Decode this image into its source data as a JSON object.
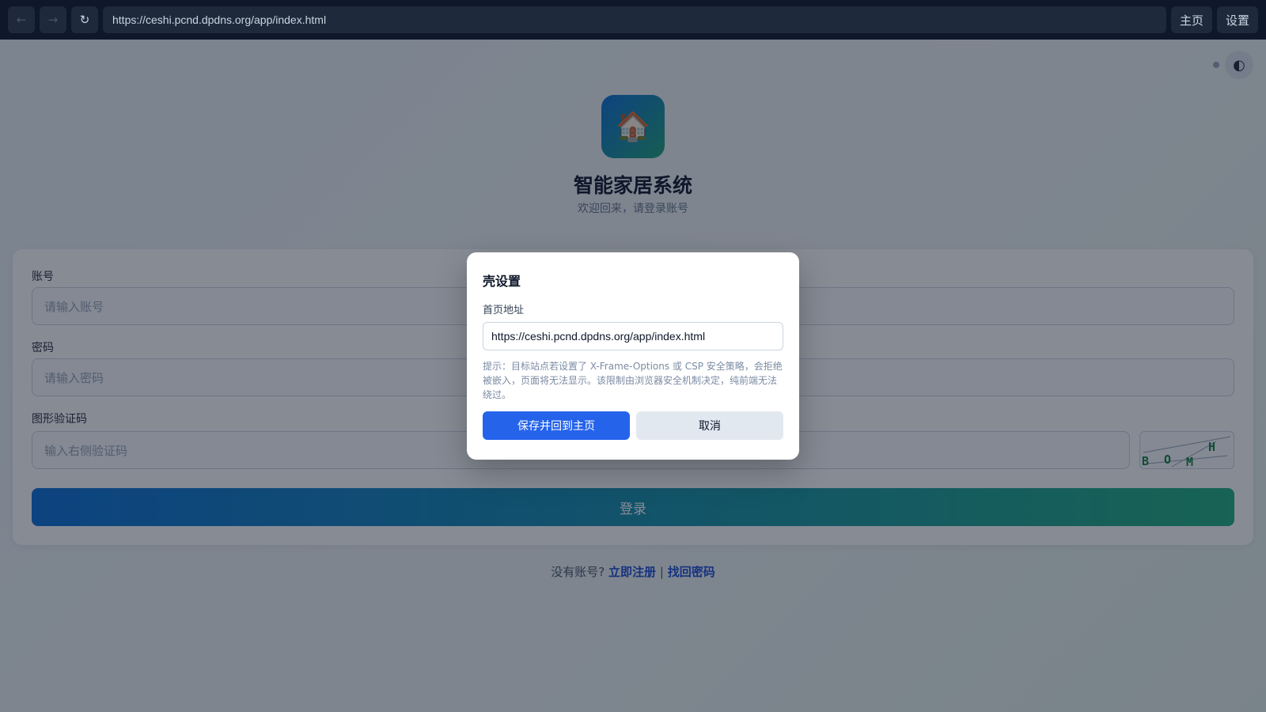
{
  "browser": {
    "back_icon": "←",
    "forward_icon": "→",
    "reload_icon": "↻",
    "url": "https://ceshi.pcnd.dpdns.org/app/index.html",
    "home_label": "主页",
    "settings_label": "设置"
  },
  "page": {
    "theme_icon": "◐",
    "logo_icon": "🏠",
    "title": "智能家居系统",
    "subtitle": "欢迎回来，请登录账号"
  },
  "login": {
    "account_label": "账号",
    "account_placeholder": "请输入账号",
    "password_label": "密码",
    "password_placeholder": "请输入密码",
    "captcha_label": "图形验证码",
    "captcha_placeholder": "输入右侧验证码",
    "captcha_chars": [
      "B",
      "O",
      "M",
      "H"
    ],
    "submit_label": "登录"
  },
  "footer": {
    "prompt": "没有账号?",
    "register_link": "立即注册",
    "separator": "|",
    "recover_link": "找回密码"
  },
  "modal": {
    "title": "壳设置",
    "home_label": "首页地址",
    "home_value": "https://ceshi.pcnd.dpdns.org/app/index.html",
    "hint": "提示：目标站点若设置了 X-Frame-Options 或 CSP 安全策略，会拒绝被嵌入，页面将无法显示。该限制由浏览器安全机制决定，纯前端无法绕过。",
    "save_label": "保存并回到主页",
    "cancel_label": "取消"
  },
  "colors": {
    "accent": "#2563eb",
    "brand_gradient_start": "#0a6fd6",
    "brand_gradient_end": "#1fae7f",
    "link": "#1d4ed8"
  }
}
